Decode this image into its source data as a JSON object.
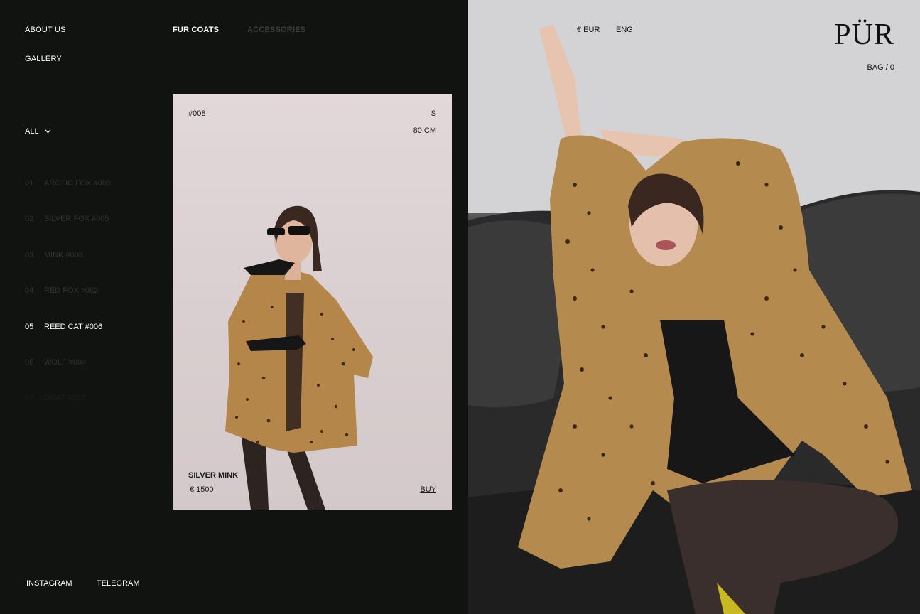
{
  "nav": {
    "about": "ABOUT US",
    "gallery": "GALLERY",
    "fur_coats": "FUR COATS",
    "accessories": "ACCESSORIES"
  },
  "filter": {
    "label": "ALL",
    "icon": "chevron-down-icon"
  },
  "coats": [
    {
      "num": "01",
      "name": "ARCTIC FOX #003"
    },
    {
      "num": "02",
      "name": "SILVER FOX #005"
    },
    {
      "num": "03",
      "name": "MINK #008"
    },
    {
      "num": "04",
      "name": "RED FOX #002"
    },
    {
      "num": "05",
      "name": "REED CAT #006"
    },
    {
      "num": "06",
      "name": "WOLF #004"
    },
    {
      "num": "07",
      "name": "GOAT #002"
    }
  ],
  "product": {
    "id": "#008",
    "size": "S",
    "length": "80 CM",
    "name": "SILVER MINK",
    "price": "€ 1500",
    "buy": "BUY"
  },
  "header": {
    "currency": "€ EUR",
    "language": "ENG",
    "logo": "PÜR",
    "bag": "BAG / 0"
  },
  "social": {
    "instagram": "INSTAGRAM",
    "telegram": "TELEGRAM"
  },
  "colors": {
    "dark_bg": "#10130f",
    "accent_fur": "#b5864a"
  }
}
